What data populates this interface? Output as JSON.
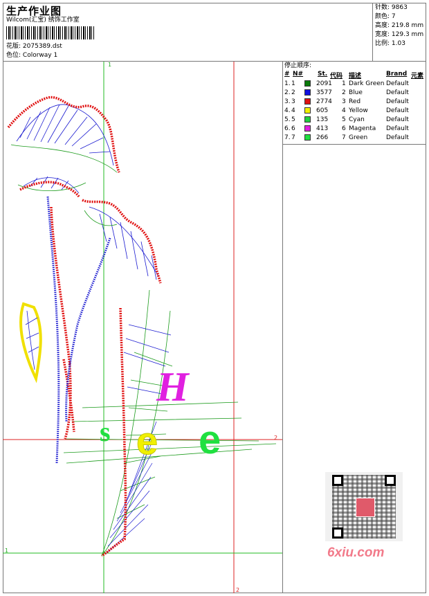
{
  "header": {
    "title": "生产作业图",
    "company": "Wilcom(汇宝) 绣饰工作室",
    "design_label": "花版:",
    "design_value": "2075389.dst",
    "colorway_label": "色位:",
    "colorway_value": "Colorway 1"
  },
  "stats": [
    {
      "label": "针数:",
      "value": "9863"
    },
    {
      "label": "颜色:",
      "value": "7"
    },
    {
      "label": "高度:",
      "value": "219.8 mm"
    },
    {
      "label": "宽度:",
      "value": "129.3 mm"
    },
    {
      "label": "比例:",
      "value": "1.03"
    }
  ],
  "stop_sequence": {
    "title": "停止顺序:",
    "columns": [
      "#",
      "N#",
      "St.",
      "代码",
      "描述",
      "Brand",
      "元素"
    ],
    "rows": [
      {
        "num": "1.",
        "n": "1",
        "st": "2091",
        "code": "1",
        "desc": "Dark Green",
        "brand": "Default",
        "color": "#0a7a0a"
      },
      {
        "num": "2.",
        "n": "2",
        "st": "3577",
        "code": "2",
        "desc": "Blue",
        "brand": "Default",
        "color": "#1010e0"
      },
      {
        "num": "3.",
        "n": "3",
        "st": "2774",
        "code": "3",
        "desc": "Red",
        "brand": "Default",
        "color": "#e01010"
      },
      {
        "num": "4.",
        "n": "4",
        "st": "605",
        "code": "4",
        "desc": "Yellow",
        "brand": "Default",
        "color": "#f0f000"
      },
      {
        "num": "5.",
        "n": "5",
        "st": "135",
        "code": "5",
        "desc": "Cyan",
        "brand": "Default",
        "color": "#20d040"
      },
      {
        "num": "6.",
        "n": "6",
        "st": "413",
        "code": "6",
        "desc": "Magenta",
        "brand": "Default",
        "color": "#e020e0"
      },
      {
        "num": "7.",
        "n": "7",
        "st": "266",
        "code": "7",
        "desc": "Green",
        "brand": "Default",
        "color": "#20e040"
      }
    ]
  },
  "canvas": {
    "guide_top": "1",
    "guide_right": "2",
    "guide_left": "1",
    "guide_bottom": "2",
    "letters": {
      "h": "H",
      "e1": "e",
      "e2": "e",
      "s": "s"
    }
  },
  "watermark": {
    "site": "6xiu.com"
  }
}
